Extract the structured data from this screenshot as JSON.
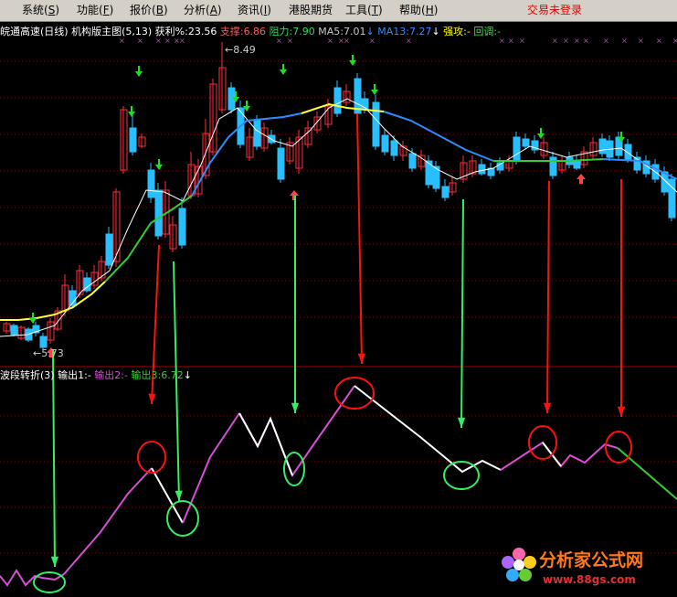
{
  "menu": [
    {
      "label": "系统",
      "key": "S"
    },
    {
      "label": "功能",
      "key": "F"
    },
    {
      "label": "报价",
      "key": "B"
    },
    {
      "label": "分析",
      "key": "A"
    },
    {
      "label": "资讯",
      "key": "I"
    },
    {
      "label": "港股期货",
      "key": ""
    },
    {
      "label": "工具",
      "key": "T"
    },
    {
      "label": "帮助",
      "key": "H"
    }
  ],
  "login_status": "交易未登录",
  "main_chart": {
    "stock_title": "皖通高速(日线)",
    "indicator_name": "机构版主图(5,13)",
    "profit_label": "获利%:",
    "profit_value": "23.56",
    "support_label": "支撑:",
    "support_value": "6.86",
    "resistance_label": "阻力:",
    "resistance_value": "7.90",
    "ma5_label": "MA5:",
    "ma5_value": "7.01",
    "ma13_label": "MA13:",
    "ma13_value": "7.27",
    "strong_label": "强攻:",
    "strong_value": "-",
    "pullback_label": "回调:",
    "pullback_value": "-",
    "high_price_label": "8.49",
    "low_price_label": "5.73"
  },
  "sub_chart": {
    "indicator_name": "波段转折(3)",
    "out1_label": "输出1:",
    "out1_value": "-",
    "out2_label": "输出2:",
    "out2_value": "-",
    "out3_label": "输出3:",
    "out3_value": "6.72"
  },
  "watermark": {
    "name": "分析家公式网",
    "url": "www.88gs.com"
  },
  "colors": {
    "rise": "#ff2b3d",
    "fall": "#29bfff",
    "ma5": "#ffffff",
    "ma13_up": "#2e8cff",
    "zigzag_up": "#d64fd6",
    "zigzag_down": "#ffffff",
    "zigzag_end": "#33cc33",
    "red_marker": "#ff1010",
    "green_marker": "#33ee66",
    "grid": "#8b0000",
    "login_text": "#e00000"
  }
}
